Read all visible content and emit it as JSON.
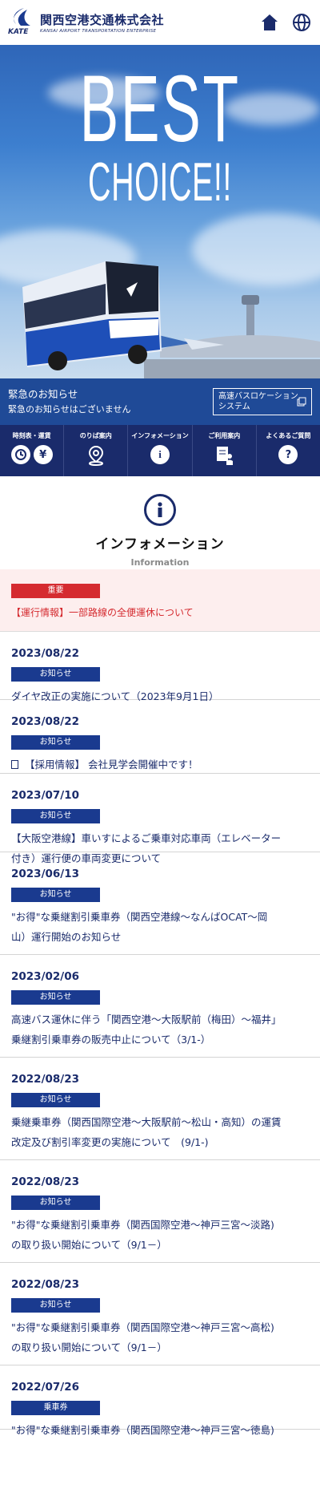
{
  "header": {
    "company_name": "関西空港交通株式会社",
    "company_name_en": "KANSAI AIRPORT TRANSPORTATION ENTERPRISE",
    "logo_abbr": "KATE",
    "home_icon": "home-icon",
    "language_icon": "globe-icon"
  },
  "hero": {
    "line1": "BEST",
    "line2": "CHOICE!!"
  },
  "notice": {
    "title": "緊急のお知らせ",
    "body": "緊急のお知らせはございません",
    "bus_location_line1": "高速バスロケーション",
    "bus_location_line2": "システム"
  },
  "nav": [
    {
      "label": "時刻表・運賃",
      "icons": [
        "clock-icon",
        "yen-icon"
      ]
    },
    {
      "label": "のりば案内",
      "icons": [
        "map-pin-icon"
      ]
    },
    {
      "label": "インフォメーション",
      "icons": [
        "info-icon"
      ]
    },
    {
      "label": "ご利用案内",
      "icons": [
        "guide-icon"
      ]
    },
    {
      "label": "よくあるご質問",
      "icons": [
        "question-icon"
      ]
    }
  ],
  "section": {
    "title": "インフォメーション",
    "subtitle": "Information"
  },
  "important": {
    "badge": "重要",
    "link": "【運行情報】一部路線の全便運休について"
  },
  "news": [
    {
      "date": "2023/08/22",
      "category": "お知らせ",
      "lines": [
        "ダイヤ改正の実施について（2023年9月1日）"
      ]
    },
    {
      "date": "2023/08/22",
      "category": "お知らせ",
      "lines": [
        "【採用情報】 会社見学会開催中です！"
      ],
      "icon": "document-icon"
    },
    {
      "date": "2023/07/10",
      "category": "お知らせ",
      "lines": [
        "【大阪空港線】車いすによるご乗車対応車両（エレベーター",
        "付き）運行便の車両変更について"
      ]
    },
    {
      "date": "2023/06/13",
      "category": "お知らせ",
      "lines": [
        "\"お得\"な乗継割引乗車券（関西空港線～なんばOCAT～岡",
        "山）運行開始のお知らせ"
      ]
    },
    {
      "date": "2023/02/06",
      "category": "お知らせ",
      "lines": [
        "高速バス運休に伴う「関西空港～大阪駅前（梅田）～福井」",
        "乗継割引乗車券の販売中止について（3/1-）"
      ]
    },
    {
      "date": "2022/08/23",
      "category": "お知らせ",
      "lines": [
        "乗継乗車券（関西国際空港～大阪駅前～松山・高知）の運賃",
        "改定及び割引率変更の実施について　(9/1-)"
      ]
    },
    {
      "date": "2022/08/23",
      "category": "お知らせ",
      "lines": [
        "\"お得\"な乗継割引乗車券（関西国際空港～神戸三宮～淡路)",
        "の取り扱い開始について（9/1－）"
      ]
    },
    {
      "date": "2022/08/23",
      "category": "お知らせ",
      "lines": [
        "\"お得\"な乗継割引乗車券（関西国際空港～神戸三宮～高松)",
        "の取り扱い開始について（9/1－）"
      ]
    },
    {
      "date": "2022/07/26",
      "category": "乗車券",
      "lines": [
        "\"お得\"な乗継割引乗車券（関西国際空港～神戸三宮～徳島)"
      ]
    }
  ],
  "colors": {
    "navy": "#1a2b6b",
    "notice_blue": "#1f4a97",
    "important_red": "#d52b30",
    "important_bg": "#fdeeee"
  }
}
